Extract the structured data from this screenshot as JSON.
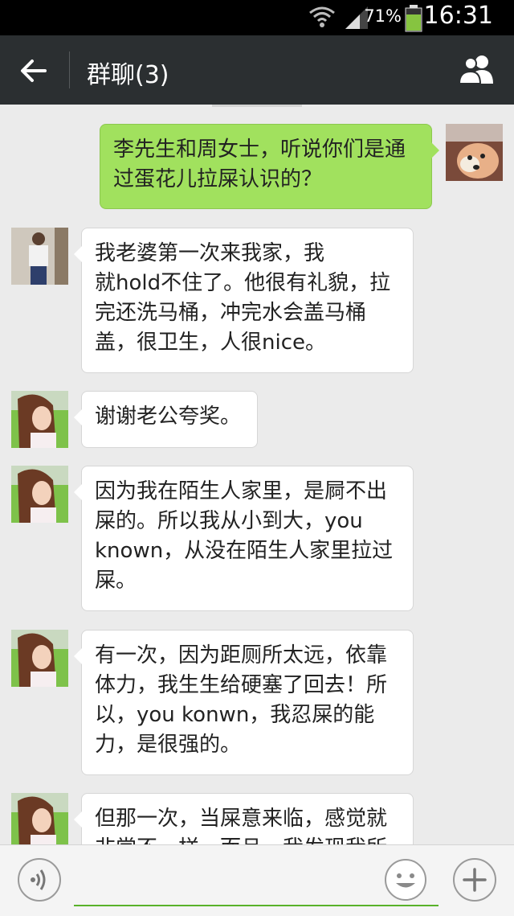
{
  "status_bar": {
    "battery_percent": "71%",
    "time": "16:31",
    "icons": [
      "wifi-icon",
      "signal-icon",
      "battery-icon"
    ]
  },
  "header": {
    "title": "群聊(3)",
    "back_icon": "arrow-left-icon",
    "members_icon": "group-members-icon"
  },
  "messages": [
    {
      "sender": "me",
      "text_lines": [
        "李先生和周女士，听说你们是通",
        "过蛋花儿拉屎认识的？"
      ]
    },
    {
      "sender": "man",
      "text_lines": [
        "我老婆第一次来我家，我",
        "就hold不住了。他很有礼貌，拉",
        "完还洗马桶，冲完水会盖马桶",
        "盖，很卫生，人很nice。"
      ]
    },
    {
      "sender": "woman",
      "text_lines": [
        "谢谢老公夸奖。"
      ]
    },
    {
      "sender": "woman",
      "text_lines": [
        "因为我在陌生人家里，是屙不出",
        "屎的。所以我从小到大，you",
        "known，从没在陌生人家里拉过",
        "屎。"
      ]
    },
    {
      "sender": "woman",
      "text_lines": [
        "有一次，因为距厕所太远，依靠",
        "体力，我生生给硬塞了回去！所",
        "以，you konwn，我忍屎的能",
        "力，是很强的。"
      ]
    },
    {
      "sender": "woman",
      "text_lines": [
        "但那一次，当屎意来临，感觉就",
        "非常不一样，而且，我发现我所"
      ]
    }
  ],
  "input_bar": {
    "voice_icon": "voice-input-icon",
    "emoji_icon": "emoji-icon",
    "plus_icon": "plus-icon",
    "text_value": ""
  },
  "colors": {
    "status_bar": "#000000",
    "title_bar": "#2b2f31",
    "chat_bg": "#ebebeb",
    "outgoing_bubble": "#a1e15e",
    "incoming_bubble": "#ffffff",
    "input_accent": "#59b22a"
  }
}
